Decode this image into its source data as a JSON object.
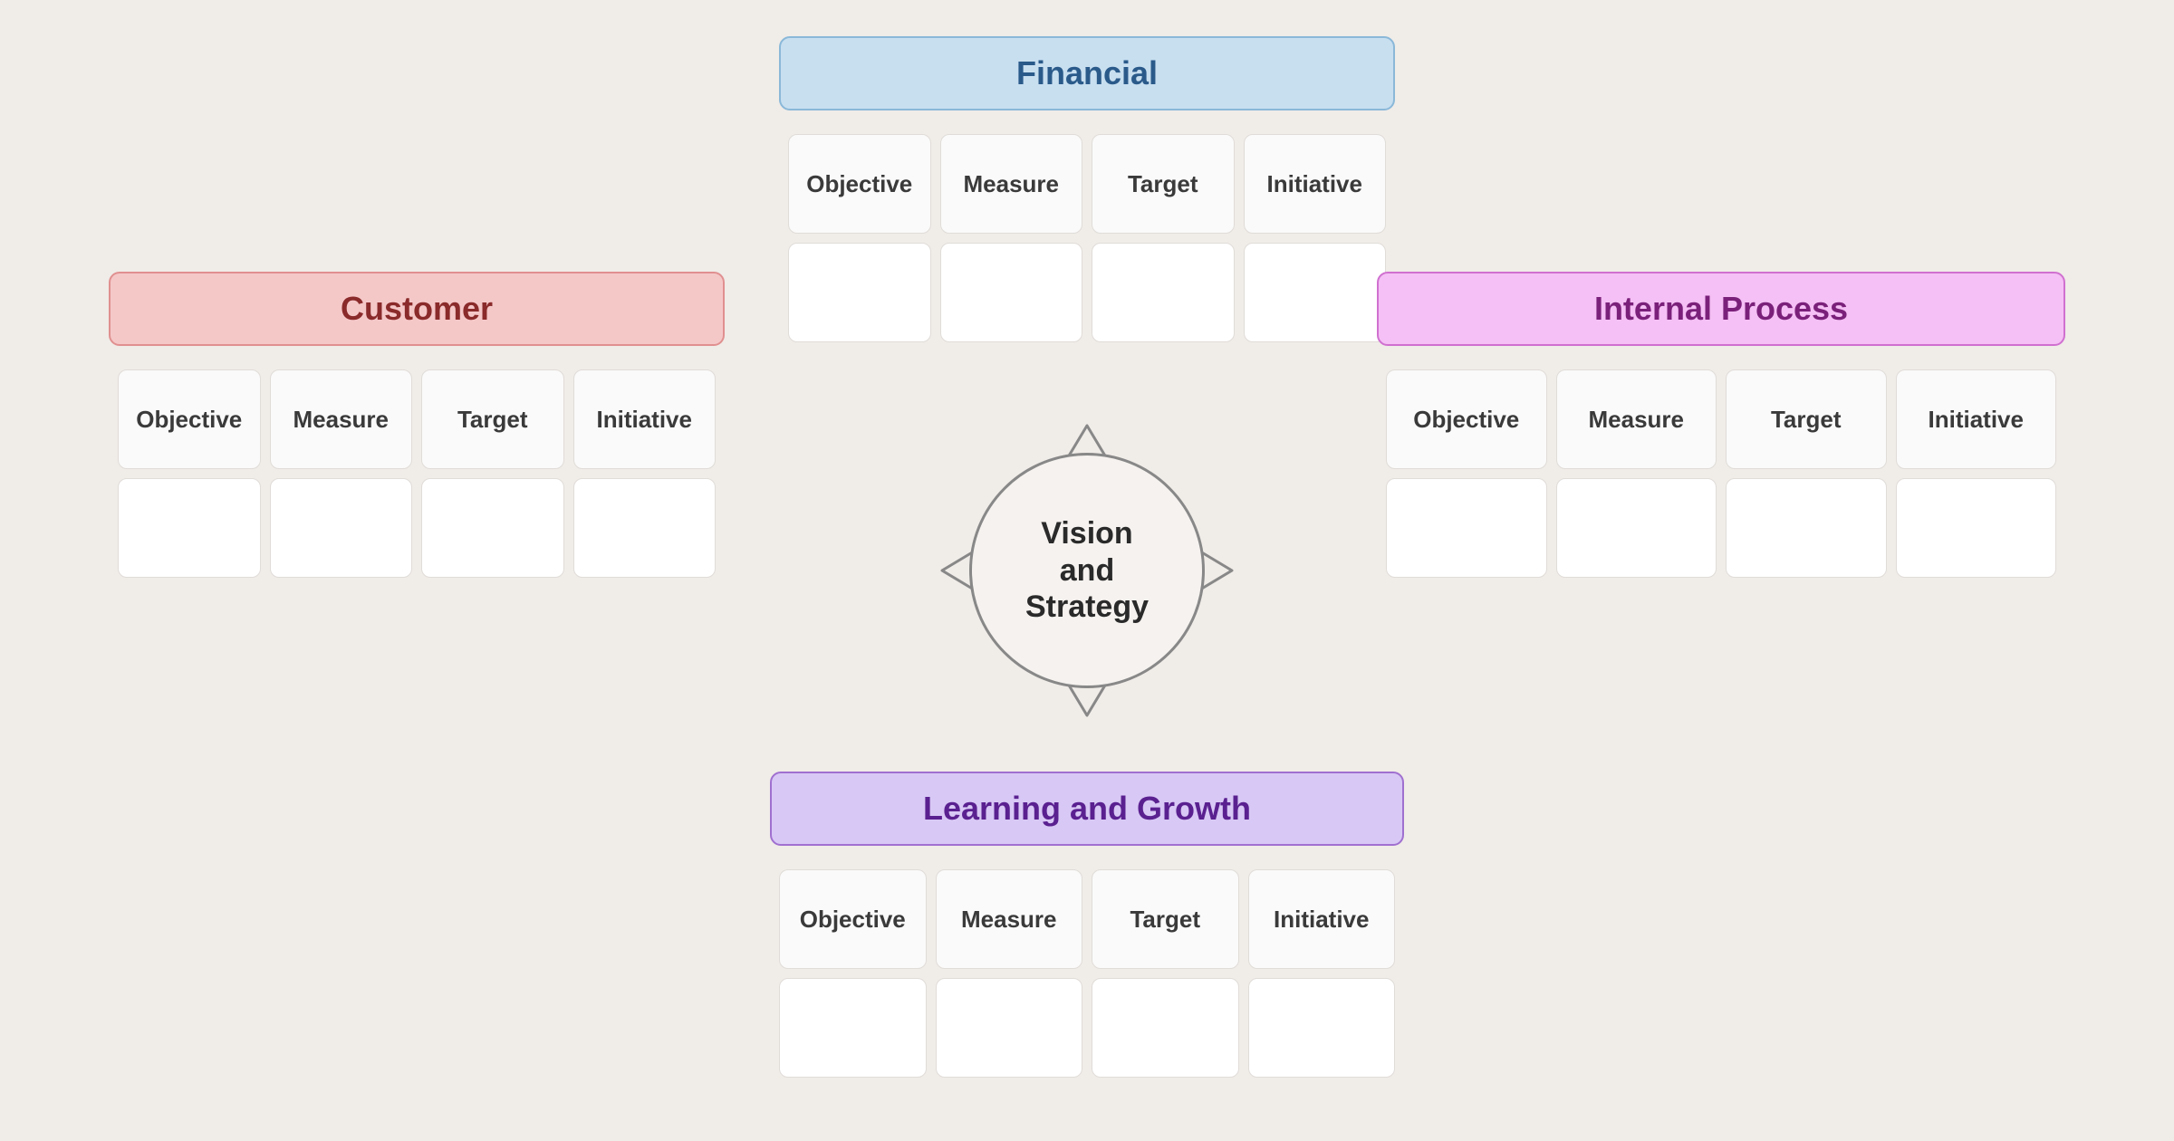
{
  "center": {
    "line1": "Vision",
    "line2": "and",
    "line3": "Strategy"
  },
  "financial": {
    "title": "Financial",
    "columns": [
      "Objective",
      "Measure",
      "Target",
      "Initiative"
    ],
    "rows": 2,
    "accent_bg": "#c8dff0",
    "accent_border": "#8ab8d8",
    "accent_text": "#2a5a8a"
  },
  "customer": {
    "title": "Customer",
    "columns": [
      "Objective",
      "Measure",
      "Target",
      "Initiative"
    ],
    "rows": 2,
    "accent_bg": "#f5c8c8",
    "accent_border": "#e09090",
    "accent_text": "#8a2a2a"
  },
  "internal": {
    "title": "Internal Process",
    "columns": [
      "Objective",
      "Measure",
      "Target",
      "Initiative"
    ],
    "rows": 2,
    "accent_bg": "#f5c0f5",
    "accent_border": "#d070d0",
    "accent_text": "#7a207a"
  },
  "learning": {
    "title": "Learning and Growth",
    "columns": [
      "Objective",
      "Measure",
      "Target",
      "Initiative"
    ],
    "rows": 2,
    "accent_bg": "#d8c8f5",
    "accent_border": "#a070d0",
    "accent_text": "#5a2090"
  }
}
